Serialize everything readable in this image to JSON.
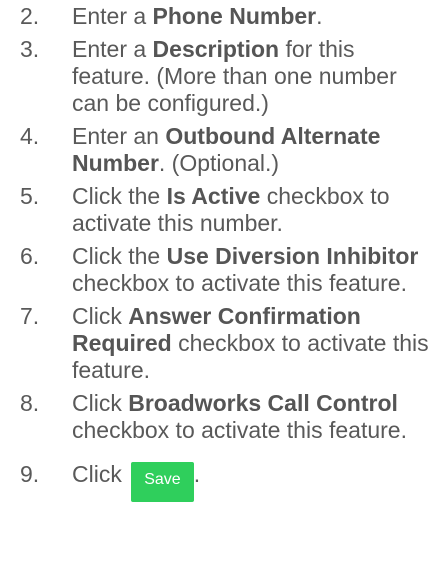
{
  "steps": [
    {
      "number": "2.",
      "parts": [
        "Enter a ",
        "Phone Number",
        "."
      ]
    },
    {
      "number": "3.",
      "parts": [
        "Enter a ",
        "Description",
        " for this feature. (More than one number can be configured.)"
      ]
    },
    {
      "number": "4.",
      "parts": [
        "Enter an ",
        "Outbound Alternate Number",
        ". (Optional.)"
      ]
    },
    {
      "number": "5.",
      "parts": [
        "Click the ",
        "Is Active",
        " checkbox to activate this number."
      ]
    },
    {
      "number": "6.",
      "parts": [
        "Click the ",
        "Use Diversion Inhibitor",
        " checkbox to activate this feature."
      ]
    },
    {
      "number": "7.",
      "parts": [
        "Click ",
        "Answer Confirmation Required",
        " checkbox to activate this feature."
      ]
    },
    {
      "number": "8.",
      "parts": [
        "Click ",
        "Broadworks Call Control",
        " checkbox to activate this feature."
      ]
    },
    {
      "number": "9.",
      "text": "Click",
      "button_label": "Save",
      "suffix": "."
    }
  ],
  "colors": {
    "text": "#595959",
    "save_button_bg": "#2fcf5c",
    "save_button_text": "#ffffff"
  }
}
